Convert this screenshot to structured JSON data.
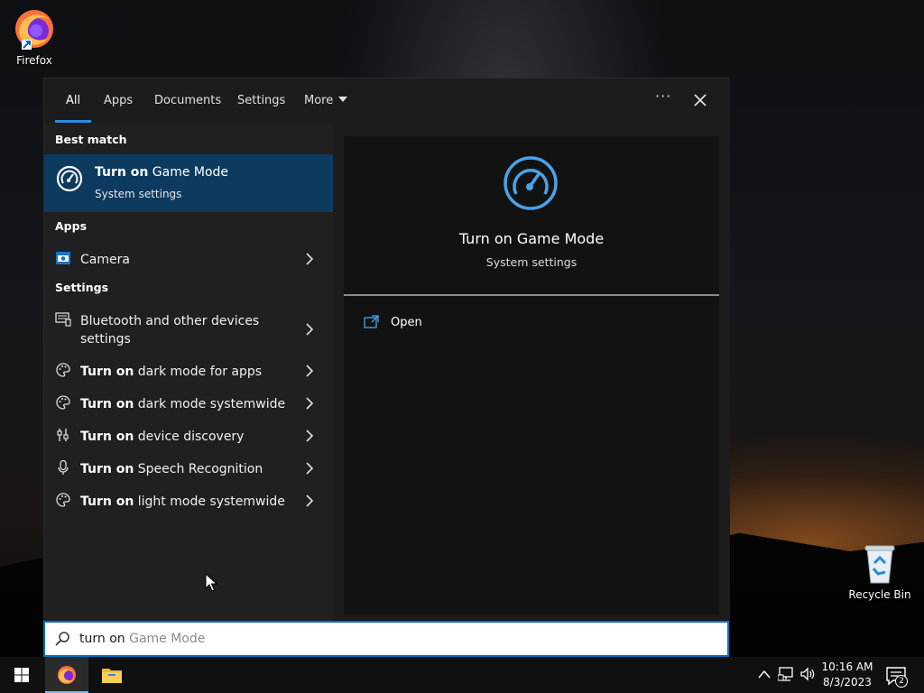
{
  "desktop": {
    "icons": [
      {
        "label": "Firefox",
        "icon": "firefox-icon"
      },
      {
        "label": "Recycle Bin",
        "icon": "recycle-bin-icon"
      }
    ]
  },
  "search": {
    "tabs": [
      "All",
      "Apps",
      "Documents",
      "Settings",
      "More"
    ],
    "active_tab": "All",
    "sections": {
      "best_match": "Best match",
      "apps": "Apps",
      "settings": "Settings"
    },
    "best_match": {
      "title_bold": "Turn on",
      "title_rest": " Game Mode",
      "subtitle": "System settings",
      "icon": "game-mode-icon"
    },
    "apps": [
      {
        "label": "Camera",
        "icon": "camera-icon"
      }
    ],
    "settings": [
      {
        "label_line1": "Bluetooth and other devices",
        "label_line2": "settings",
        "icon": "bluetooth-devices-icon"
      },
      {
        "bold": "Turn on",
        "rest": " dark mode for apps",
        "icon": "palette-icon"
      },
      {
        "bold": "Turn on",
        "rest": " dark mode systemwide",
        "icon": "palette-icon"
      },
      {
        "bold": "Turn on",
        "rest": " device discovery",
        "icon": "device-discovery-icon"
      },
      {
        "bold": "Turn on",
        "rest": " Speech Recognition",
        "icon": "microphone-icon"
      },
      {
        "bold": "Turn on",
        "rest": " light mode systemwide",
        "icon": "palette-icon"
      }
    ],
    "detail": {
      "title": "Turn on Game Mode",
      "subtitle": "System settings",
      "action_open": "Open"
    },
    "query_typed": "turn on",
    "query_suggestion": " Game Mode"
  },
  "taskbar": {
    "time": "10:16 AM",
    "date": "8/3/2023",
    "notification_count": "2"
  },
  "colors": {
    "accent": "#2f8ae0",
    "best_match_bg": "#0d3a5f",
    "search_border": "#0b6fbf"
  }
}
